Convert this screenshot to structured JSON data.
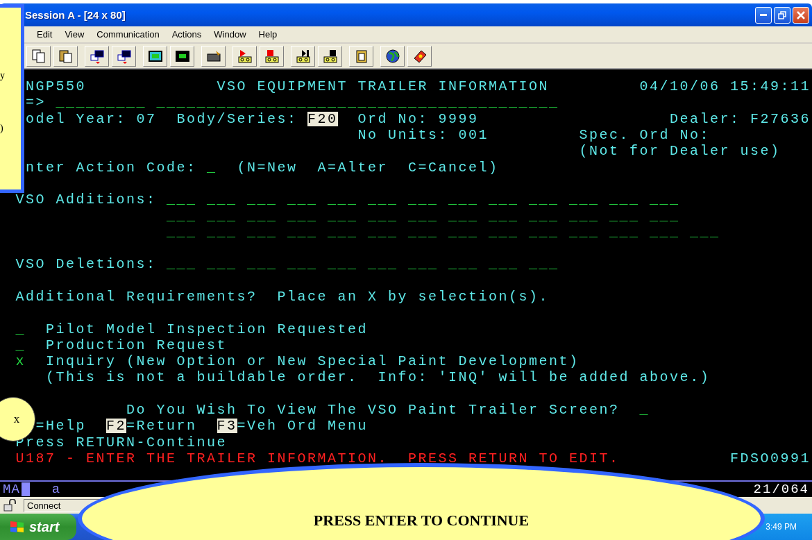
{
  "window": {
    "title": "Session A - [24 x 80]"
  },
  "menu": [
    "Edit",
    "View",
    "Communication",
    "Actions",
    "Window",
    "Help"
  ],
  "terminal": {
    "rows": [
      {
        "segments": [
          {
            "kind": "text",
            "text": "NGP550"
          },
          {
            "kind": "text",
            "text": "VSO EQUIPMENT TRAILER INFORMATION"
          },
          {
            "kind": "text",
            "text": "04/10/06 15:49:11"
          }
        ]
      },
      {
        "segments": [
          {
            "kind": "text",
            "text": "=>"
          },
          {
            "kind": "field",
            "text": "_________"
          },
          {
            "kind": "field",
            "text": "________________________________________"
          }
        ]
      },
      {
        "segments": [
          {
            "kind": "text",
            "text": "odel Year: 07"
          },
          {
            "kind": "text",
            "text": "Body/Series:"
          },
          {
            "kind": "inverse",
            "text": "F20"
          },
          {
            "kind": "text",
            "text": "Ord No: 9999"
          },
          {
            "kind": "text",
            "text": "Dealer: F27636"
          }
        ]
      },
      {
        "segments": [
          {
            "kind": "text",
            "text": "No Units: 001"
          },
          {
            "kind": "text",
            "text": "Spec. Ord No:"
          }
        ]
      },
      {
        "segments": [
          {
            "kind": "text",
            "text": "(Not for Dealer use)"
          }
        ]
      },
      {
        "segments": [
          {
            "kind": "text",
            "text": "nter Action Code:"
          },
          {
            "kind": "field",
            "text": "_"
          },
          {
            "kind": "text",
            "text": "(N=New  A=Alter  C=Cancel)"
          }
        ]
      },
      {
        "segments": [
          {
            "kind": "text",
            "text": "VSO Additions:"
          },
          {
            "kind": "field",
            "text": "___"
          },
          {
            "kind": "field",
            "text": "___"
          },
          {
            "kind": "field",
            "text": "___"
          },
          {
            "kind": "field",
            "text": "___"
          },
          {
            "kind": "field",
            "text": "___"
          },
          {
            "kind": "field",
            "text": "___"
          },
          {
            "kind": "field",
            "text": "___"
          },
          {
            "kind": "field",
            "text": "___"
          },
          {
            "kind": "field",
            "text": "___"
          },
          {
            "kind": "field",
            "text": "___"
          },
          {
            "kind": "field",
            "text": "___"
          },
          {
            "kind": "field",
            "text": "___"
          },
          {
            "kind": "field",
            "text": "___"
          }
        ]
      },
      {
        "segments": [
          {
            "kind": "field",
            "text": "___"
          },
          {
            "kind": "field",
            "text": "___"
          },
          {
            "kind": "field",
            "text": "___"
          },
          {
            "kind": "field",
            "text": "___"
          },
          {
            "kind": "field",
            "text": "___"
          },
          {
            "kind": "field",
            "text": "___"
          },
          {
            "kind": "field",
            "text": "___"
          },
          {
            "kind": "field",
            "text": "___"
          },
          {
            "kind": "field",
            "text": "___"
          },
          {
            "kind": "field",
            "text": "___"
          },
          {
            "kind": "field",
            "text": "___"
          },
          {
            "kind": "field",
            "text": "___"
          },
          {
            "kind": "field",
            "text": "___"
          }
        ]
      },
      {
        "segments": [
          {
            "kind": "field",
            "text": "___"
          },
          {
            "kind": "field",
            "text": "___"
          },
          {
            "kind": "field",
            "text": "___"
          },
          {
            "kind": "field",
            "text": "___"
          },
          {
            "kind": "field",
            "text": "___"
          },
          {
            "kind": "field",
            "text": "___"
          },
          {
            "kind": "field",
            "text": "___"
          },
          {
            "kind": "field",
            "text": "___"
          },
          {
            "kind": "field",
            "text": "___"
          },
          {
            "kind": "field",
            "text": "___"
          },
          {
            "kind": "field",
            "text": "___"
          },
          {
            "kind": "field",
            "text": "___"
          },
          {
            "kind": "field",
            "text": "___"
          },
          {
            "kind": "field",
            "text": "___"
          }
        ]
      },
      {
        "segments": [
          {
            "kind": "text",
            "text": "VSO Deletions:"
          },
          {
            "kind": "field",
            "text": "___"
          },
          {
            "kind": "field",
            "text": "___"
          },
          {
            "kind": "field",
            "text": "___"
          },
          {
            "kind": "field",
            "text": "___"
          },
          {
            "kind": "field",
            "text": "___"
          },
          {
            "kind": "field",
            "text": "___"
          },
          {
            "kind": "field",
            "text": "___"
          },
          {
            "kind": "field",
            "text": "___"
          },
          {
            "kind": "field",
            "text": "___"
          },
          {
            "kind": "field",
            "text": "___"
          }
        ]
      },
      {
        "segments": [
          {
            "kind": "text",
            "text": "Additional Requirements?  Place an X by selection(s)."
          }
        ]
      },
      {
        "segments": [
          {
            "kind": "field",
            "text": "_"
          },
          {
            "kind": "text",
            "text": "Pilot Model Inspection Requested"
          }
        ]
      },
      {
        "segments": [
          {
            "kind": "field",
            "text": "_"
          },
          {
            "kind": "text",
            "text": "Production Request"
          }
        ]
      },
      {
        "segments": [
          {
            "kind": "field",
            "text": "x"
          },
          {
            "kind": "text",
            "text": "Inquiry (New Option or New Special Paint Development)"
          }
        ]
      },
      {
        "segments": [
          {
            "kind": "text",
            "text": "(This is not a buildable order.  Info: 'INQ' will be added above.)"
          }
        ]
      },
      {
        "segments": [
          {
            "kind": "text",
            "text": "Do You Wish To View The VSO Paint Trailer Screen?"
          },
          {
            "kind": "field",
            "text": "_"
          }
        ]
      },
      {
        "segments": [
          {
            "kind": "text",
            "text": "=Help"
          },
          {
            "kind": "inverse",
            "text": "F2"
          },
          {
            "kind": "text",
            "text": "=Return"
          },
          {
            "kind": "inverse",
            "text": "F3"
          },
          {
            "kind": "text",
            "text": "=Veh Ord Menu"
          }
        ]
      },
      {
        "segments": [
          {
            "kind": "text",
            "text": "Press RETURN-Continue"
          }
        ]
      },
      {
        "segments": [
          {
            "kind": "error",
            "text": "U187 - ENTER THE TRAILER INFORMATION.  PRESS RETURN TO EDIT."
          },
          {
            "kind": "text",
            "text": "FDSO0991"
          }
        ]
      }
    ]
  },
  "status_line": {
    "mode": "MA",
    "input": "a",
    "position": "21/064"
  },
  "connection_bar": {
    "status": "Connect"
  },
  "taskbar": {
    "start": "start",
    "clock": "3:49 PM"
  },
  "callouts": {
    "note_fragments": [
      "y",
      ")"
    ],
    "dismiss": "x",
    "banner": "PRESS ENTER TO CONTINUE"
  }
}
